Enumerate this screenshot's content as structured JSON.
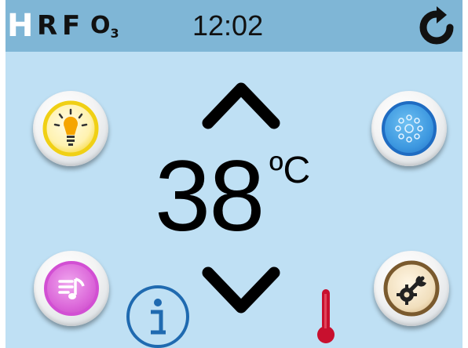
{
  "status_bar": {
    "indicators": [
      {
        "label": "H",
        "meaning": "heater-on"
      },
      {
        "label": "R"
      },
      {
        "label": "F"
      },
      {
        "label": "O",
        "sub": "3"
      }
    ],
    "time": "12:02",
    "refresh_icon": "refresh-icon"
  },
  "controls": {
    "light_icon": "light-bulb-icon",
    "jets_icon": "jets-icon",
    "music_icon": "music-icon",
    "settings_icon": "settings-icon",
    "up_icon": "chevron-up-icon",
    "down_icon": "chevron-down-icon",
    "info_icon": "info-icon",
    "thermometer_icon": "thermometer-icon"
  },
  "temperature": {
    "value": "38",
    "unit": "ºC"
  },
  "colors": {
    "screen_bg": "#bfe0f4",
    "top_bar": "#7fb6d6",
    "light_ring": "#f4d21e",
    "jets_ring": "#2a7fd0",
    "music_ring": "#d24fd3",
    "settings_ring": "#7a5a2e",
    "info_blue": "#1f6ab0",
    "thermometer_red": "#c8102e"
  }
}
